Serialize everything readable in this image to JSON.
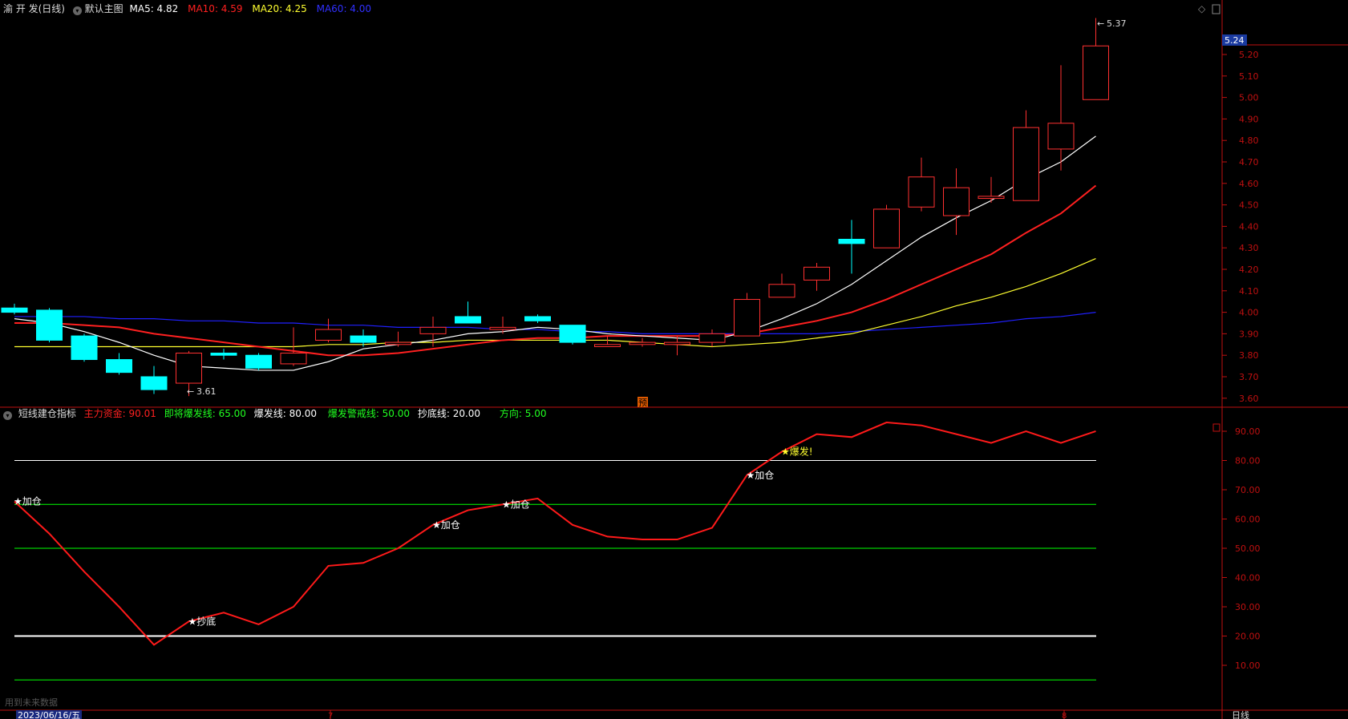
{
  "header": {
    "symbol": "渝 开 发(日线)",
    "main_chart": "默认主图",
    "ma5": "MA5: 4.82",
    "ma10": "MA10: 4.59",
    "ma20": "MA20: 4.25",
    "ma60": "MA60: 4.00"
  },
  "indicator_header": {
    "name": "短线建仓指标",
    "main_fund": "主力资金: 90.01",
    "pre_burst": "即将爆发线: 65.00",
    "burst": "爆发线: 80.00",
    "burst_warn": "爆发警戒线: 50.00",
    "bottom": "抄底线: 20.00",
    "direction": "方向: 5.00"
  },
  "labels": {
    "high_mark": "5.37",
    "low_mark": "3.61",
    "current_price": "5.24",
    "pre_flag": "预",
    "date": "2023/06/16/五",
    "month7": "7",
    "month8": "8",
    "period_tab": "日线",
    "future_data": "用到未来数据"
  },
  "colors": {
    "up": "#ff3030",
    "down": "#00ffff",
    "ma5": "#ffffff",
    "ma10": "#ff2020",
    "ma20": "#ffff30",
    "ma60": "#2020ff",
    "axis": "#c01010"
  },
  "chart_data": [
    {
      "type": "candlestick",
      "y_ticks": [
        "5.20",
        "5.10",
        "5.00",
        "4.90",
        "4.80",
        "4.70",
        "4.60",
        "4.50",
        "4.40",
        "4.30",
        "4.20",
        "4.10",
        "4.00",
        "3.90",
        "3.80",
        "3.70",
        "3.60"
      ],
      "ylim": [
        3.55,
        5.4
      ],
      "ohlc": [
        [
          4.02,
          4.04,
          3.99,
          4.0
        ],
        [
          4.01,
          4.02,
          3.86,
          3.87
        ],
        [
          3.89,
          3.9,
          3.77,
          3.78
        ],
        [
          3.78,
          3.81,
          3.71,
          3.72
        ],
        [
          3.7,
          3.75,
          3.62,
          3.64
        ],
        [
          3.67,
          3.82,
          3.61,
          3.81
        ],
        [
          3.81,
          3.83,
          3.78,
          3.8
        ],
        [
          3.8,
          3.81,
          3.73,
          3.74
        ],
        [
          3.76,
          3.93,
          3.75,
          3.81
        ],
        [
          3.87,
          3.97,
          3.86,
          3.92
        ],
        [
          3.89,
          3.92,
          3.84,
          3.86
        ],
        [
          3.85,
          3.91,
          3.84,
          3.86
        ],
        [
          3.9,
          3.98,
          3.84,
          3.93
        ],
        [
          3.98,
          4.05,
          3.95,
          3.95
        ],
        [
          3.92,
          3.98,
          3.9,
          3.93
        ],
        [
          3.98,
          3.99,
          3.95,
          3.96
        ],
        [
          3.94,
          3.94,
          3.85,
          3.86
        ],
        [
          3.84,
          3.89,
          3.84,
          3.85
        ],
        [
          3.85,
          3.88,
          3.84,
          3.86
        ],
        [
          3.85,
          3.89,
          3.8,
          3.86
        ],
        [
          3.86,
          3.92,
          3.84,
          3.9
        ],
        [
          3.89,
          4.09,
          3.89,
          4.06
        ],
        [
          4.07,
          4.18,
          4.07,
          4.13
        ],
        [
          4.15,
          4.23,
          4.1,
          4.21
        ],
        [
          4.34,
          4.43,
          4.18,
          4.32
        ],
        [
          4.3,
          4.5,
          4.3,
          4.48
        ],
        [
          4.49,
          4.72,
          4.47,
          4.63
        ],
        [
          4.45,
          4.67,
          4.36,
          4.58
        ],
        [
          4.53,
          4.63,
          4.51,
          4.54
        ],
        [
          4.52,
          4.94,
          4.52,
          4.86
        ],
        [
          4.76,
          5.15,
          4.66,
          4.88
        ],
        [
          4.99,
          5.37,
          4.99,
          5.24
        ]
      ],
      "ma5": [
        3.97,
        3.95,
        3.91,
        3.86,
        3.8,
        3.75,
        3.74,
        3.73,
        3.73,
        3.77,
        3.83,
        3.85,
        3.87,
        3.9,
        3.91,
        3.93,
        3.92,
        3.9,
        3.89,
        3.88,
        3.87,
        3.91,
        3.97,
        4.04,
        4.13,
        4.24,
        4.35,
        4.44,
        4.52,
        4.62,
        4.7,
        4.82
      ],
      "ma10": [
        3.95,
        3.95,
        3.94,
        3.93,
        3.9,
        3.88,
        3.86,
        3.84,
        3.82,
        3.8,
        3.8,
        3.81,
        3.83,
        3.85,
        3.87,
        3.88,
        3.88,
        3.89,
        3.89,
        3.89,
        3.89,
        3.9,
        3.93,
        3.96,
        4.0,
        4.06,
        4.13,
        4.2,
        4.27,
        4.37,
        4.46,
        4.59
      ],
      "ma20": [
        3.84,
        3.84,
        3.84,
        3.84,
        3.84,
        3.84,
        3.84,
        3.84,
        3.84,
        3.85,
        3.85,
        3.86,
        3.86,
        3.87,
        3.87,
        3.87,
        3.87,
        3.87,
        3.86,
        3.85,
        3.84,
        3.85,
        3.86,
        3.88,
        3.9,
        3.94,
        3.98,
        4.03,
        4.07,
        4.12,
        4.18,
        4.25
      ],
      "ma60": [
        3.98,
        3.98,
        3.98,
        3.97,
        3.97,
        3.96,
        3.96,
        3.95,
        3.95,
        3.94,
        3.94,
        3.93,
        3.93,
        3.93,
        3.92,
        3.92,
        3.91,
        3.91,
        3.9,
        3.9,
        3.9,
        3.9,
        3.9,
        3.9,
        3.91,
        3.92,
        3.93,
        3.94,
        3.95,
        3.97,
        3.98,
        4.0
      ]
    },
    {
      "type": "line",
      "title": "短线建仓指标",
      "y_ticks": [
        "90.00",
        "80.00",
        "70.00",
        "60.00",
        "50.00",
        "40.00",
        "30.00",
        "20.00",
        "10.00"
      ],
      "ylim": [
        0,
        100
      ],
      "series": [
        {
          "name": "主力资金",
          "values": [
            66,
            55,
            42,
            30,
            17,
            25,
            28,
            24,
            30,
            44,
            45,
            50,
            58,
            63,
            65,
            67,
            58,
            54,
            53,
            53,
            57,
            75,
            83,
            89,
            88,
            93,
            92,
            89,
            86,
            90,
            86,
            90.01
          ]
        }
      ],
      "levels": [
        {
          "name": "爆发线",
          "value": 80,
          "color": "#ffffff"
        },
        {
          "name": "即将爆发线",
          "value": 65,
          "color": "#00ff00"
        },
        {
          "name": "爆发警戒线",
          "value": 50,
          "color": "#00ff00"
        },
        {
          "name": "抄底线",
          "value": 20,
          "color": "#ffffff"
        },
        {
          "name": "方向",
          "value": 5,
          "color": "#00ff00"
        }
      ],
      "annotations": [
        {
          "index": 0,
          "label": "★加仓",
          "color": "#ffffff"
        },
        {
          "index": 5,
          "label": "★抄底",
          "color": "#ffffff"
        },
        {
          "index": 12,
          "label": "★加仓",
          "color": "#ffffff"
        },
        {
          "index": 14,
          "label": "★加仓",
          "color": "#ffffff"
        },
        {
          "index": 21,
          "label": "★加仓",
          "color": "#ffffff"
        },
        {
          "index": 22,
          "label": "★爆发!",
          "color": "#ffff30"
        }
      ]
    }
  ]
}
